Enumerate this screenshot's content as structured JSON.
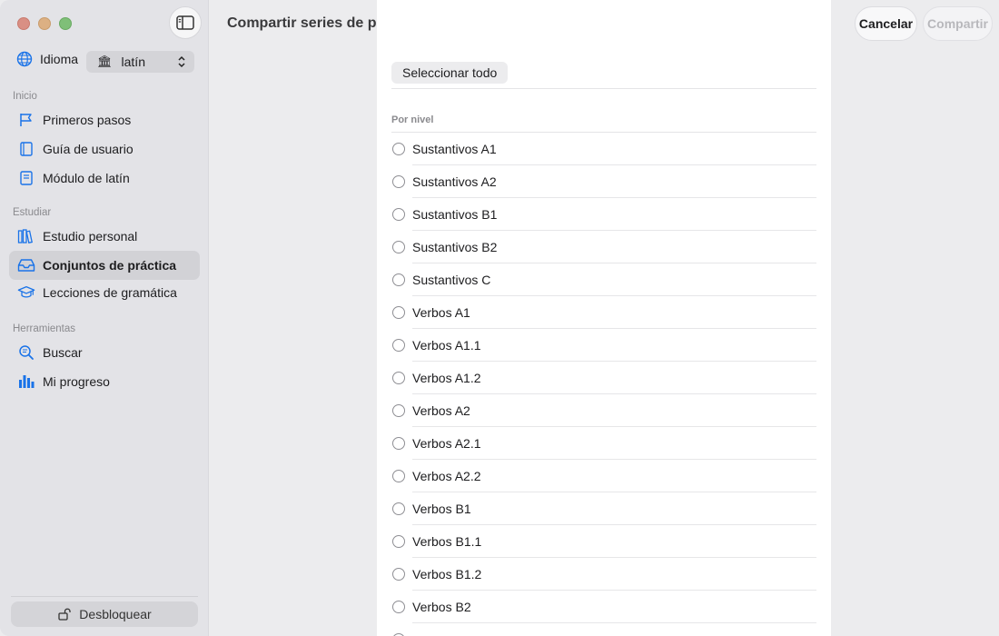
{
  "sidebar": {
    "language_label": "Idioma",
    "language_value": "latín",
    "sections": [
      {
        "title": "Inicio",
        "items": [
          {
            "label": "Primeros pasos",
            "icon": "flag-icon"
          },
          {
            "label": "Guía de usuario",
            "icon": "book-icon"
          },
          {
            "label": "Módulo de latín",
            "icon": "book-closed-icon"
          }
        ]
      },
      {
        "title": "Estudiar",
        "items": [
          {
            "label": "Estudio personal",
            "icon": "books-icon"
          },
          {
            "label": "Conjuntos de práctica",
            "icon": "tray-icon",
            "active": true
          },
          {
            "label": "Lecciones de gramática",
            "icon": "graduation-cap-icon"
          }
        ]
      },
      {
        "title": "Herramientas",
        "items": [
          {
            "label": "Buscar",
            "icon": "magnifier-icon"
          },
          {
            "label": "Mi progreso",
            "icon": "bar-chart-icon"
          }
        ]
      }
    ],
    "unlock_label": "Desbloquear"
  },
  "header": {
    "title": "Compartir series de práctica",
    "cancel_label": "Cancelar",
    "share_label": "Compartir"
  },
  "sheet": {
    "select_all_label": "Seleccionar todo",
    "group_header": "Por nivel",
    "rows": [
      "Sustantivos A1",
      "Sustantivos A2",
      "Sustantivos B1",
      "Sustantivos B2",
      "Sustantivos C",
      "Verbos A1",
      "Verbos A1.1",
      "Verbos A1.2",
      "Verbos A2",
      "Verbos A2.1",
      "Verbos A2.2",
      "Verbos B1",
      "Verbos B1.1",
      "Verbos B1.2",
      "Verbos B2"
    ]
  },
  "colors": {
    "accent": "#1a73e8",
    "sidebar_bg": "#e3e3e7",
    "active_bg": "#d2d2d6"
  }
}
